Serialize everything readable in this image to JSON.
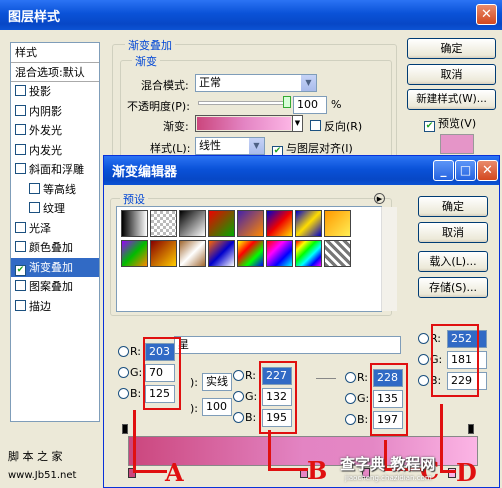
{
  "outer": {
    "title": "图层样式",
    "styles_header": "样式",
    "blending_options": "混合选项:默认",
    "style_items": [
      {
        "label": "投影",
        "checked": false,
        "sub": false
      },
      {
        "label": "内阴影",
        "checked": false,
        "sub": false
      },
      {
        "label": "外发光",
        "checked": false,
        "sub": false
      },
      {
        "label": "内发光",
        "checked": false,
        "sub": false
      },
      {
        "label": "斜面和浮雕",
        "checked": false,
        "sub": false
      },
      {
        "label": "等高线",
        "checked": false,
        "sub": true
      },
      {
        "label": "纹理",
        "checked": false,
        "sub": true
      },
      {
        "label": "光泽",
        "checked": false,
        "sub": false
      },
      {
        "label": "颜色叠加",
        "checked": false,
        "sub": false
      },
      {
        "label": "渐变叠加",
        "checked": true,
        "sub": false,
        "selected": true
      },
      {
        "label": "图案叠加",
        "checked": false,
        "sub": false
      },
      {
        "label": "描边",
        "checked": false,
        "sub": false
      }
    ],
    "overlay_group": "渐变叠加",
    "gradient_subgroup": "渐变",
    "blend_mode_label": "混合模式:",
    "blend_mode_value": "正常",
    "opacity_label": "不透明度(P):",
    "opacity_value": "100",
    "opacity_unit": "%",
    "gradient_label": "渐变:",
    "reverse_label": "反向(R)",
    "style_label": "样式(L):",
    "style_value": "线性",
    "align_label": "与图层对齐(I)",
    "align_checked": true,
    "btn_ok": "确定",
    "btn_cancel": "取消",
    "btn_new_style": "新建样式(W)...",
    "preview_label": "预览(V)",
    "preview_checked": true
  },
  "editor": {
    "title": "渐变编辑器",
    "presets_label": "预设",
    "btn_ok": "确定",
    "btn_cancel": "取消",
    "btn_load": "载入(L)...",
    "btn_save": "存储(S)...",
    "name_value_partial": "星",
    "partial_label_1": "):",
    "partial_label_2": "实线",
    "partial_label_3": "):",
    "partial_value_100": "100"
  },
  "color_panels": [
    {
      "id": "A",
      "r": "203",
      "g": "70",
      "b": "125"
    },
    {
      "id": "B",
      "r": "227",
      "g": "132",
      "b": "195"
    },
    {
      "id": "C",
      "r": "228",
      "g": "135",
      "b": "197"
    },
    {
      "id": "D",
      "r": "252",
      "g": "181",
      "b": "229"
    }
  ],
  "channel_labels": {
    "r": "R:",
    "g": "G:",
    "b": "B:"
  },
  "annotations": {
    "letter_a": "A",
    "letter_b": "B",
    "letter_c": "C",
    "letter_d": "D"
  },
  "watermarks": {
    "left_top": "脚 本 之 家",
    "left_bottom": "www.Jb51.net",
    "right": "查字典 教程网",
    "right_small": "jiaocheng.chazidian.com"
  },
  "colors": {
    "gradient_start": "#cb467d",
    "gradient_mid": "#e384c3",
    "gradient_end": "#fcb5e5",
    "annotation_red": "#e01010",
    "selection_blue": "#316ac5"
  }
}
